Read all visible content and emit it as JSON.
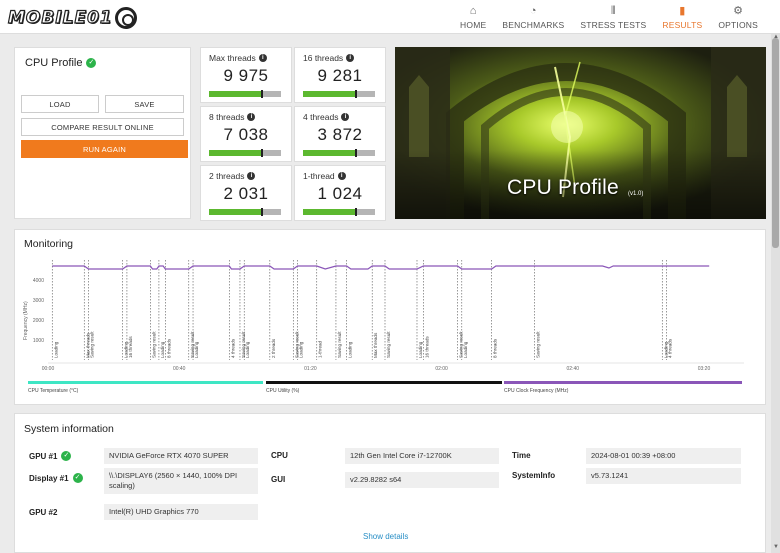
{
  "app": {
    "logo_text": "MOBILE01"
  },
  "nav": [
    {
      "label": "HOME",
      "icon": "home-icon",
      "glyph": "⌂",
      "active": false
    },
    {
      "label": "BENCHMARKS",
      "icon": "gauge-icon",
      "glyph": "◔",
      "active": false
    },
    {
      "label": "STRESS TESTS",
      "icon": "stress-bars-icon",
      "glyph": "⫴",
      "active": false
    },
    {
      "label": "RESULTS",
      "icon": "results-chart-icon",
      "glyph": "▮",
      "active": true
    },
    {
      "label": "OPTIONS",
      "icon": "gear-icon",
      "glyph": "⚙",
      "active": false
    }
  ],
  "profile": {
    "title": "CPU Profile",
    "load_label": "LOAD",
    "save_label": "SAVE",
    "compare_label": "COMPARE RESULT ONLINE",
    "run_again_label": "RUN AGAIN"
  },
  "scores": [
    {
      "label": "Max threads",
      "value": "9 975",
      "fill": 0.74
    },
    {
      "label": "16 threads",
      "value": "9 281",
      "fill": 0.74
    },
    {
      "label": "8 threads",
      "value": "7 038",
      "fill": 0.73
    },
    {
      "label": "4 threads",
      "value": "3 872",
      "fill": 0.74
    },
    {
      "label": "2 threads",
      "value": "2 031",
      "fill": 0.74
    },
    {
      "label": "1-thread",
      "value": "1 024",
      "fill": 0.74
    }
  ],
  "hero": {
    "title": "CPU Profile",
    "version": "(v1.0)"
  },
  "monitoring": {
    "title": "Monitoring",
    "y_label": "Frequency (MHz)",
    "y_ticks": [
      "4000",
      "3000",
      "2000",
      "1000"
    ],
    "x_ticks": [
      "00:00",
      "00:40",
      "01:20",
      "02:00",
      "02:40",
      "03:20"
    ],
    "markers": [
      "Loading",
      "Max threads",
      "Saving result",
      "Loading",
      "16 threads",
      "Saving result",
      "Loading",
      "8 threads",
      "Saving result",
      "Loading",
      "4 threads",
      "Saving result",
      "Loading",
      "2 threads",
      "Saving result",
      "Loading",
      "1-thread",
      "Saving result"
    ],
    "legend": [
      {
        "label": "CPU Temperature (°C)",
        "color": "#3ee6c4"
      },
      {
        "label": "CPU Utility (%)",
        "color": "#111111"
      },
      {
        "label": "CPU Clock Frequency (MHz)",
        "color": "#8a56b8"
      }
    ]
  },
  "chart_data": {
    "type": "line",
    "title": "",
    "xlabel": "",
    "ylabel": "Frequency (MHz)",
    "xlim": [
      0,
      230
    ],
    "ylim": [
      0,
      5000
    ],
    "series": [
      {
        "name": "CPU Clock Frequency (MHz)",
        "color": "#8a56b8",
        "x": [
          2,
          17,
          19,
          35,
          37,
          48,
          49,
          51,
          52,
          54,
          55,
          66,
          68,
          85,
          86,
          90,
          92,
          104,
          106,
          115,
          117,
          126,
          130,
          135,
          140,
          142,
          150,
          152,
          158,
          160,
          173,
          176,
          192,
          194,
          208,
          210,
          218,
          228,
          230,
          235,
          238,
          260,
          263,
          265,
          280,
          290,
          300,
          310
        ],
        "y": [
          4700,
          4700,
          4550,
          4550,
          4700,
          4700,
          4550,
          4550,
          4700,
          4700,
          4550,
          4550,
          4700,
          4700,
          4550,
          4550,
          4700,
          4700,
          4550,
          4550,
          4700,
          4700,
          4550,
          4700,
          4700,
          4550,
          4550,
          4700,
          4700,
          4550,
          4550,
          4700,
          4700,
          4550,
          4550,
          4700,
          4700,
          4700,
          4700,
          4700,
          4700,
          4700,
          4600,
          4700,
          4700,
          4700,
          4700,
          4700
        ]
      }
    ],
    "marker_x": [
      2,
      17,
      19,
      35,
      37,
      48,
      52,
      55,
      66,
      68,
      85,
      90,
      92,
      104,
      115,
      117,
      126,
      135,
      140,
      152,
      158,
      173,
      176,
      192,
      194,
      208,
      228,
      288,
      290
    ]
  },
  "sysinfo": {
    "title": "System information",
    "rows": [
      {
        "key": "GPU #1",
        "value": "NVIDIA GeForce RTX 4070 SUPER",
        "check": true
      },
      {
        "key": "Display #1",
        "value": "\\\\.\\DISPLAY6 (2560 × 1440, 100% DPI scaling)",
        "check": true
      },
      {
        "key": "GPU #2",
        "value": "Intel(R) UHD Graphics 770",
        "check": false
      },
      {
        "key": "CPU",
        "value": "12th Gen Intel Core i7-12700K",
        "check": false
      },
      {
        "key": "GUI",
        "value": "v2.29.8282 s64",
        "check": false
      },
      {
        "key": "Time",
        "value": "2024-08-01 00:39 +08:00",
        "check": false
      },
      {
        "key": "SystemInfo",
        "value": "v5.73.1241",
        "check": false
      }
    ],
    "show_details_label": "Show details"
  }
}
